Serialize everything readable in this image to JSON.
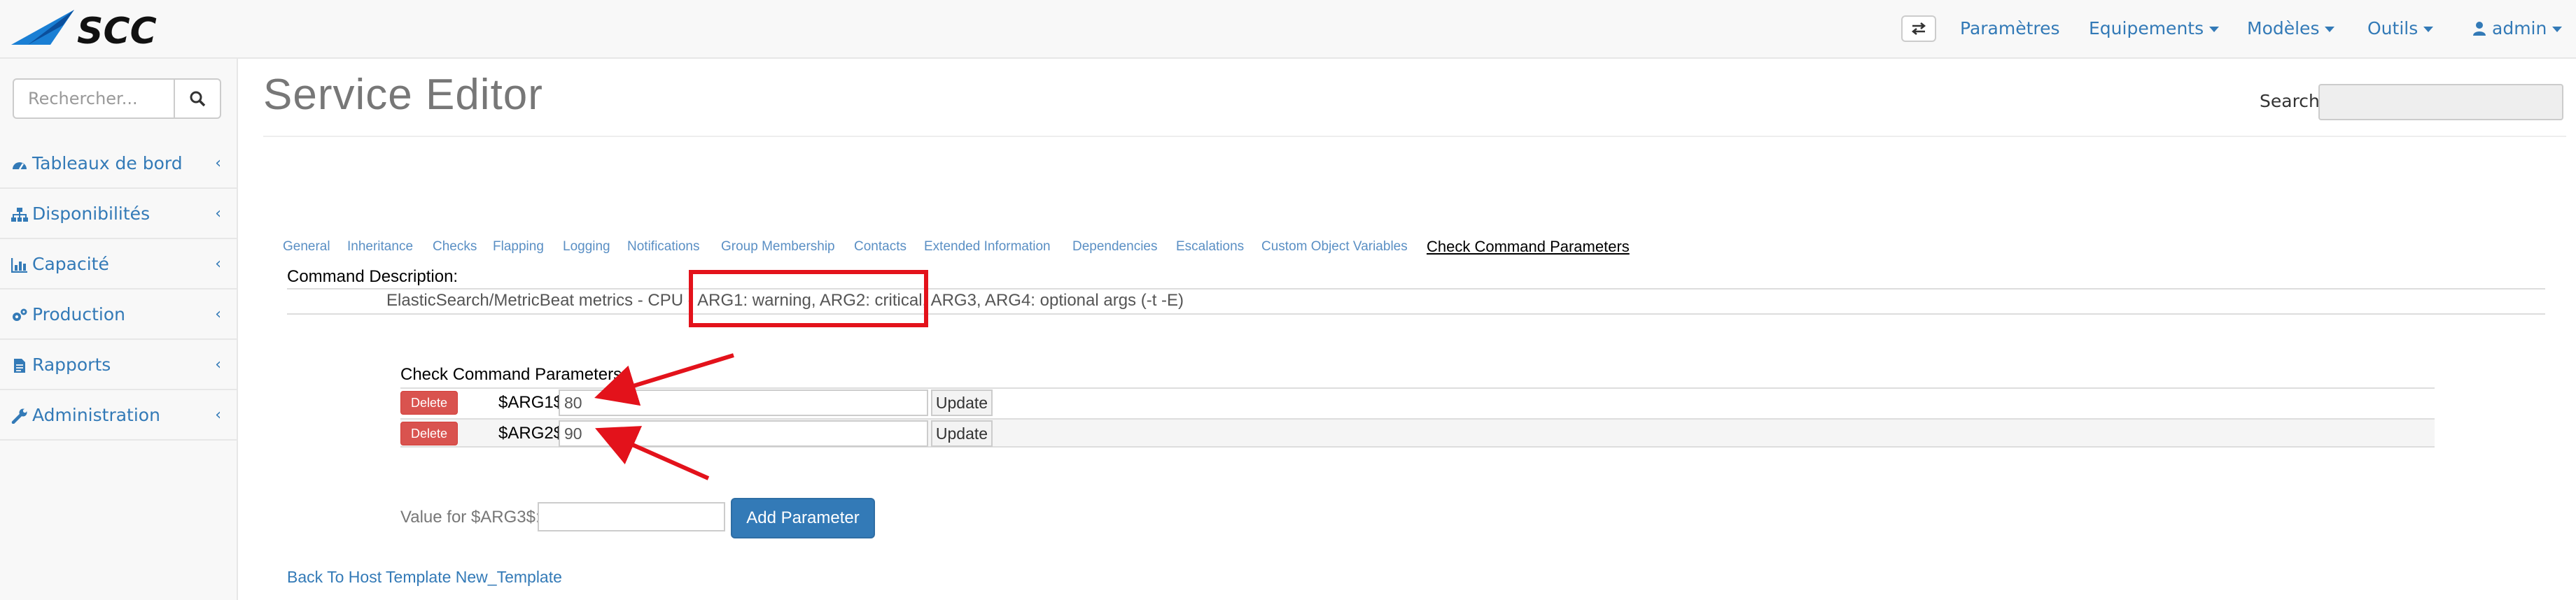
{
  "navbar": {
    "logo_text": "SCC",
    "swap_icon": "exchange-icon",
    "items": [
      {
        "label": "Paramètres",
        "has_caret": false
      },
      {
        "label": "Equipements",
        "has_caret": true
      },
      {
        "label": "Modèles",
        "has_caret": true
      },
      {
        "label": "Outils",
        "has_caret": true
      },
      {
        "label": "admin",
        "has_caret": true,
        "icon": "user-icon"
      }
    ]
  },
  "sidebar": {
    "search_placeholder": "Rechercher...",
    "items": [
      {
        "label": "Tableaux de bord",
        "icon": "tachometer-icon"
      },
      {
        "label": "Disponibilités",
        "icon": "sitemap-icon"
      },
      {
        "label": "Capacité",
        "icon": "bar-chart-icon"
      },
      {
        "label": "Production",
        "icon": "cogs-icon"
      },
      {
        "label": "Rapports",
        "icon": "file-text-icon"
      },
      {
        "label": "Administration",
        "icon": "wrench-icon"
      }
    ],
    "chevron": "‹"
  },
  "main": {
    "title": "Service Editor",
    "search_label": "Search:",
    "tabs": [
      {
        "label": "General"
      },
      {
        "label": "Inheritance"
      },
      {
        "label": "Checks"
      },
      {
        "label": "Flapping"
      },
      {
        "label": "Logging"
      },
      {
        "label": "Notifications"
      },
      {
        "label": "Group Membership"
      },
      {
        "label": "Contacts"
      },
      {
        "label": "Extended Information"
      },
      {
        "label": "Dependencies"
      },
      {
        "label": "Escalations"
      },
      {
        "label": "Custom Object Variables"
      },
      {
        "label": "Check Command Parameters"
      }
    ],
    "active_tab": "Check Command Parameters",
    "command_description_label": "Command Description:",
    "command_description": "ElasticSearch/MetricBeat metrics - CPU - ARG1: warning, ARG2: critical, ARG3, ARG4: optional args (-t -E)",
    "check_command_parameters_label": "Check Command Parameters:",
    "parameters": [
      {
        "delete_label": "Delete",
        "name": "$ARG1$:",
        "value": "80",
        "update_label": "Update"
      },
      {
        "delete_label": "Delete",
        "name": "$ARG2$:",
        "value": "90",
        "update_label": "Update"
      }
    ],
    "new_value_label": "Value for $ARG3$:",
    "new_value": "",
    "add_button_label": "Add Parameter",
    "back_link": "Back To Host Template New_Template"
  },
  "colors": {
    "link": "#337ab7",
    "danger": "#d9534f",
    "annotation_red": "#e3121b",
    "tab_link": "#5a8fc4"
  }
}
